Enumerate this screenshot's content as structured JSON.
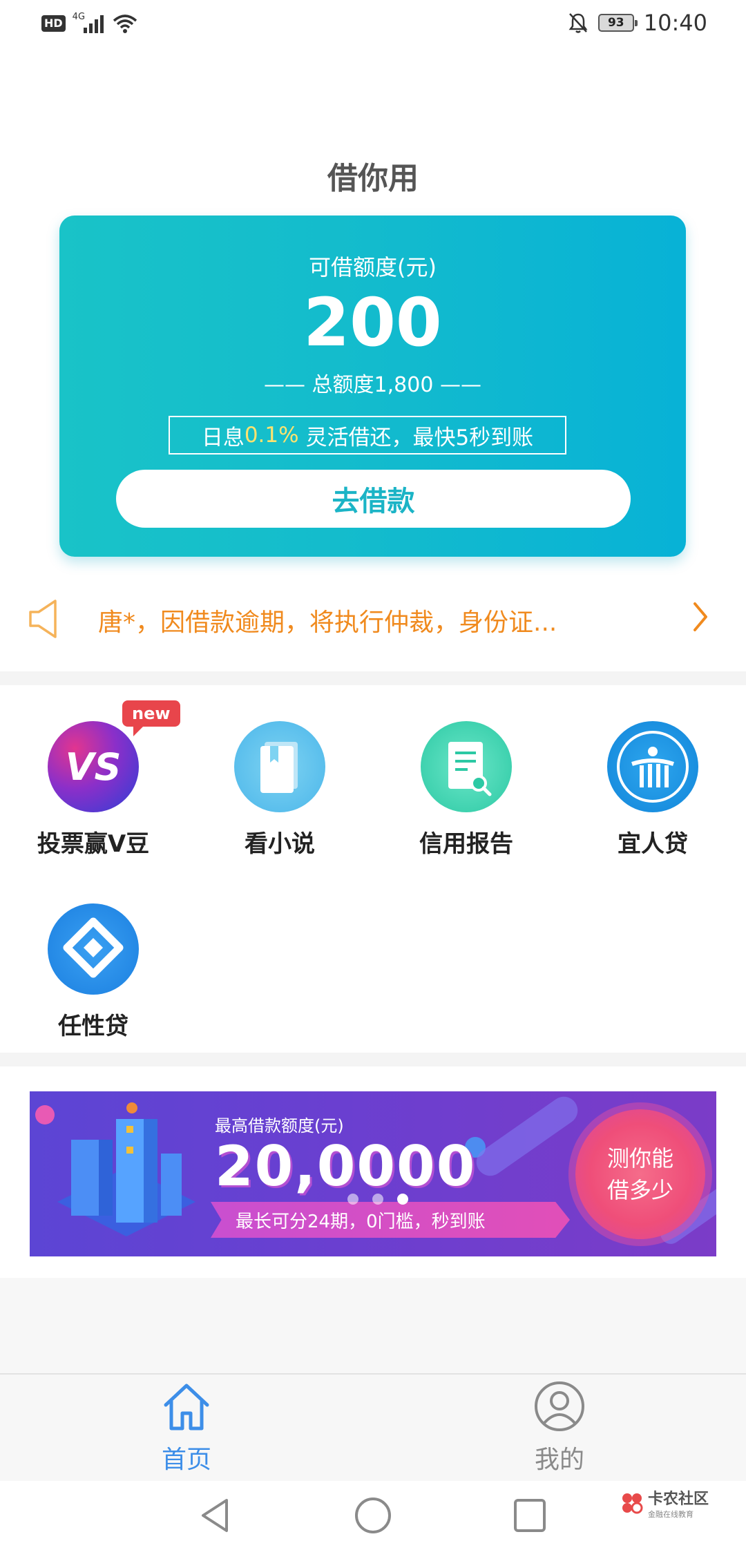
{
  "status_bar": {
    "hd": "HD",
    "network": "4G",
    "battery": "93",
    "time": "10:40"
  },
  "header": {
    "title": "借你用"
  },
  "credit_card": {
    "limit_label": "可借额度(元)",
    "limit_amount": "200",
    "total_label": "—— 总额度1,800 ——",
    "promo_prefix": "日息",
    "promo_rate": "0.1%",
    "promo_suffix": " 灵活借还，最快5秒到账",
    "borrow_button": "去借款"
  },
  "notice": {
    "text": "唐*，因借款逾期，将执行仲裁，身份证..."
  },
  "services": [
    {
      "label": "投票赢V豆",
      "icon": "vs-vote-icon",
      "badge": "new",
      "mark": "VS"
    },
    {
      "label": "看小说",
      "icon": "book-icon"
    },
    {
      "label": "信用报告",
      "icon": "credit-report-icon"
    },
    {
      "label": "宜人贷",
      "icon": "yirendai-logo-icon"
    },
    {
      "label": "任性贷",
      "icon": "renxingdai-logo-icon"
    }
  ],
  "banner": {
    "label": "最高借款额度(元)",
    "amount": "20,0000",
    "ribbon": "最长可分24期，0门槛，秒到账",
    "cta_line1": "测你能",
    "cta_line2": "借多少"
  },
  "bottom_nav": [
    {
      "label": "首页",
      "icon": "home-icon",
      "active": true
    },
    {
      "label": "我的",
      "icon": "profile-icon",
      "active": false
    }
  ],
  "watermark": {
    "name": "卡农社区",
    "sub": "金融在线教育"
  },
  "colors": {
    "accent": "#1bb4c6",
    "nav_active": "#3d8ee8",
    "notice": "#f08a1e",
    "badge": "#e8454b"
  }
}
